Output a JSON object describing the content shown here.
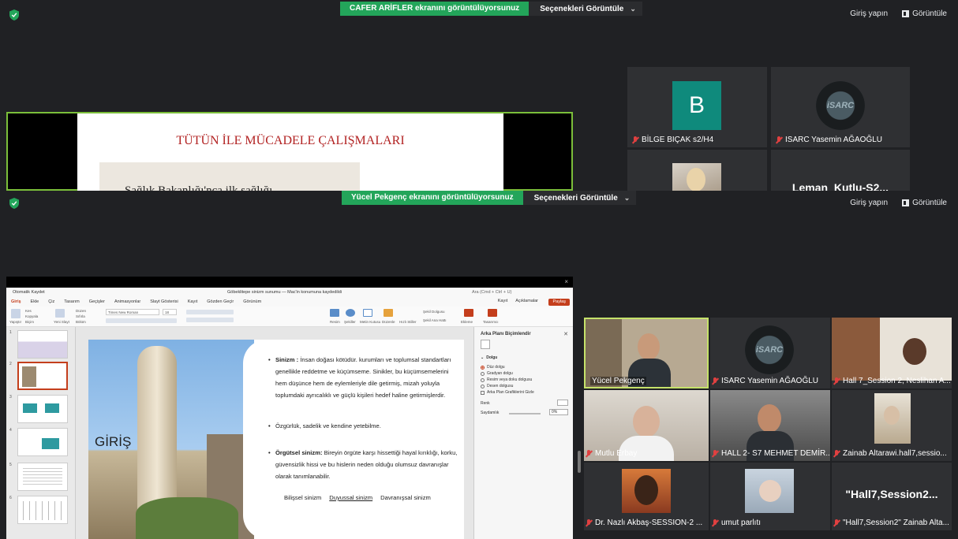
{
  "top_zoom": {
    "sharing_banner": "CAFER ARİFLER ekranını görüntülüyorsunuz",
    "view_options": "Seçenekleri Görüntüle",
    "sign_in": "Giriş yapın",
    "view": "Görüntüle",
    "slide_title": "TÜTÜN İLE MÜCADELE ÇALIŞMALARI",
    "slide_partial": "Sağlık Bakanlığı'nca ilk sağlığı",
    "participants": [
      {
        "name": "BİLGE BIÇAK s2/H4",
        "avatar_letter": "B",
        "avatar_color": "#0f8a7c"
      },
      {
        "name": "ISARC Yasemin AĞAOĞLU",
        "logo_text": "iSARC"
      },
      {
        "name": ""
      },
      {
        "name": "Leman_Kutlu-S2..."
      }
    ]
  },
  "bottom_zoom": {
    "sharing_banner": "Yücel Pekgenç ekranını görüntülüyorsunuz",
    "view_options": "Seçenekleri Görüntüle",
    "sign_in": "Giriş yapın",
    "view": "Görüntüle",
    "close_glyph": "×",
    "powerpoint": {
      "autosave": "Otomatik Kaydet",
      "doc_title": "Göbeklitepe sinizm sunumu — Mac'in konumuna kaydedildi",
      "search": "Ara (Cmd + Ctrl + U)",
      "menu": [
        "Giriş",
        "Ekle",
        "Çiz",
        "Tasarım",
        "Geçişler",
        "Animasyonlar",
        "Slayt Gösterisi",
        "Kayıt",
        "Gözden Geçir",
        "Görünüm"
      ],
      "record": "Kayıt",
      "comments": "Açıklamalar",
      "share": "Paylaş",
      "ribbon": {
        "paste": "Yapıştır",
        "cut": "Kes",
        "copy": "Kopyala",
        "format": "Biçim",
        "new_slide": "Yeni Slayt",
        "layout": "Düzen",
        "reset": "Sıfırla",
        "section": "Bölüm",
        "font": "Times New Roman",
        "size": "18",
        "picture": "Resim",
        "shapes": "Şekiller",
        "textbox": "Metin Kutusu",
        "arrange": "Düzenle",
        "quick_styles": "Hızlı Stiller",
        "shape_fill": "Şekil Dolgusu",
        "shape_outline": "Şekil Ana Hattı",
        "designer": "Tasarımcı",
        "slides_btn": "Ekleme"
      },
      "format_pane": {
        "title": "Arka Planı Biçimlendir",
        "section": "Dolgu",
        "options": [
          "Düz dolgu",
          "Gradyan dolgu",
          "Resim veya doku dolgusu",
          "Desen dolgusu"
        ],
        "hide_bg": "Arka Plan Grafiklerini Gizle",
        "color": "Renk",
        "transparency": "Saydamlık",
        "transparency_value": "0%"
      },
      "slide": {
        "heading": "GİRİŞ",
        "bullets": [
          {
            "term": "Sinizm :",
            "text": " İnsan doğası kötüdür. kurumları ve toplumsal standartları genellikle reddetme ve küçümseme.  Sinikler, bu küçümsemelerini hem düşünce hem de eylemleriyle dile getirmiş, mizah yoluyla toplumdaki ayrıcalıklı ve güçlü kişileri hedef haline getirmişlerdir."
          },
          {
            "term": "",
            "text": "Özgürlük, sadelik ve kendine yetebilme."
          },
          {
            "term": "Örgütsel sinizm:",
            "text": " Bireyin örgüte karşı hissettiği hayal kırıklığı, korku, güvensizlik hissi ve bu hislerin neden olduğu olumsuz davranışlar olarak tanımlanabilir."
          }
        ],
        "footer_items": [
          "Bilişsel sinizm",
          "Duyussal sinizm",
          "Davranışsal sinizm"
        ]
      }
    },
    "participants": [
      {
        "name": "Yücel Pekgenç"
      },
      {
        "name": "ISARC Yasemin AĞAOĞLU",
        "logo_text": "iSARC"
      },
      {
        "name": "Hall 7_Session 2, Neslihan A..."
      },
      {
        "name": "Mutlu Erbay"
      },
      {
        "name": "HALL 2- S7 MEHMET DEMİR..."
      },
      {
        "name": "Zainab Altarawi.hall7,sessio..."
      },
      {
        "name": "Dr. Nazlı Akbaş-SESSION-2 ..."
      },
      {
        "name": "umut parlıtı"
      },
      {
        "name": "\"Hall7,Session2\" Zainab Alta...",
        "title_text": "\"Hall7,Session2..."
      }
    ]
  },
  "colors": {
    "zoom_bg": "#202124",
    "share_green": "#23a55a",
    "active_speaker": "#c5e26a",
    "ppt_accent": "#c43e1c"
  }
}
